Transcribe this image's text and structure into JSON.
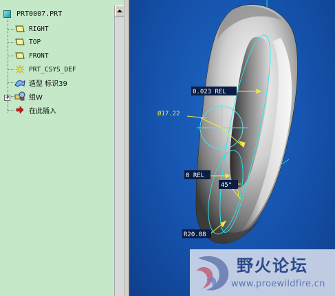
{
  "model_tree": {
    "root_label": "PRT0007.PRT",
    "items": [
      {
        "label": "RIGHT",
        "icon": "datum-plane-icon"
      },
      {
        "label": "TOP",
        "icon": "datum-plane-icon"
      },
      {
        "label": "FRONT",
        "icon": "datum-plane-icon"
      },
      {
        "label": "PRT_CSYS_DEF",
        "icon": "coordinate-system-icon"
      },
      {
        "label": "造型 标识39",
        "icon": "style-feature-icon"
      },
      {
        "label": "组W",
        "icon": "group-icon",
        "expandable": true
      },
      {
        "label": "在此插入",
        "icon": "insert-here-arrow-icon"
      }
    ]
  },
  "viewport": {
    "dimensions": [
      {
        "text": "0.023 REL"
      },
      {
        "text": "Ø17.22"
      },
      {
        "text": "0 REL"
      },
      {
        "text": "45°"
      },
      {
        "text": "R20.08"
      }
    ]
  },
  "watermark": {
    "site_name": "野火论坛",
    "url": "www.proewildfire.cn"
  },
  "colors": {
    "tree_background": "#c4e8c8",
    "viewport_background": "#1552ac",
    "curve_cyan": "#2ee6ee",
    "dimension_yellow": "#f0ea40"
  }
}
